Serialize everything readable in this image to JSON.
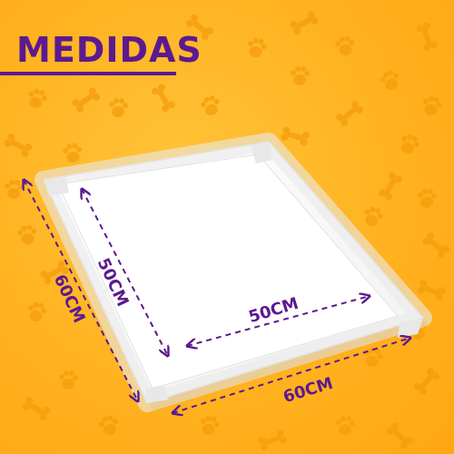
{
  "title": "MEDIDAS",
  "measurements": {
    "inner_height": "50CM",
    "inner_width": "50CM",
    "outer_height": "60CM",
    "outer_width": "60CM"
  },
  "colors": {
    "background": "#ffb21f",
    "accent": "#5b1a8f",
    "pattern": "#f59d0b",
    "pad": "#ffffff",
    "pad_border": "#e6e6e6"
  },
  "icons": [
    "paw-icon",
    "bone-icon"
  ]
}
